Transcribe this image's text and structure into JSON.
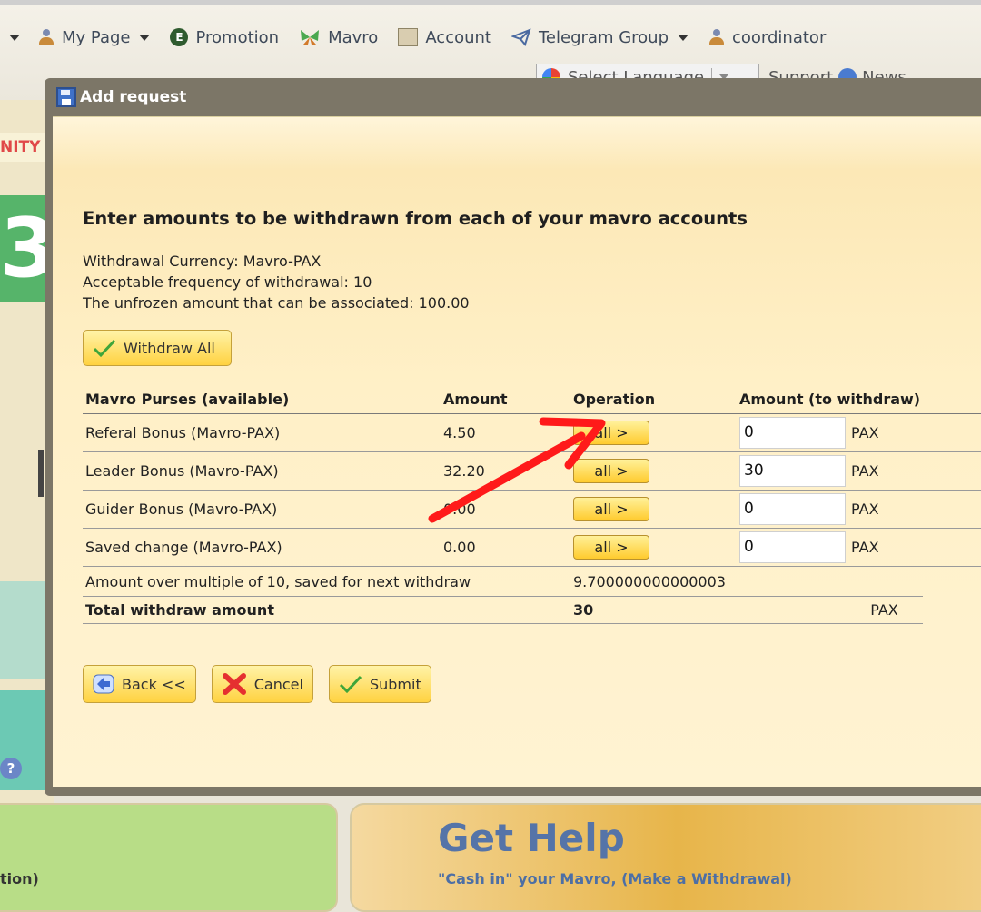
{
  "nav": {
    "items": [
      {
        "label": "My Page",
        "icon": "person-icon"
      },
      {
        "label": "Promotion",
        "icon": "e-badge-icon"
      },
      {
        "label": "Mavro",
        "icon": "butterfly-icon"
      },
      {
        "label": "Account",
        "icon": "ledger-icon"
      },
      {
        "label": "Telegram Group",
        "icon": "telegram-icon"
      },
      {
        "label": "coordinator",
        "icon": "person-icon"
      }
    ],
    "language_label": "Select Language",
    "support": "Support",
    "news": "News"
  },
  "left_panel": {
    "nity": "NITY",
    "big_digit": "3",
    "help_icon": "?"
  },
  "dialog": {
    "title": "Add request",
    "heading": "Enter amounts to be withdrawn from each of your mavro accounts",
    "info": [
      "Withdrawal Currency: Mavro-PAX",
      "Acceptable frequency of withdrawal: 10",
      "The unfrozen amount that can be associated: 100.00"
    ],
    "withdraw_all": "Withdraw All",
    "table": {
      "headers": [
        "Mavro Purses (available)",
        "Amount",
        "Operation",
        "Amount (to withdraw)"
      ],
      "rows": [
        {
          "purse": "Referal Bonus (Mavro-PAX)",
          "amount": "4.50",
          "op": "all >",
          "value": "0",
          "unit": "PAX"
        },
        {
          "purse": "Leader Bonus (Mavro-PAX)",
          "amount": "32.20",
          "op": "all >",
          "value": "30",
          "unit": "PAX"
        },
        {
          "purse": "Guider Bonus (Mavro-PAX)",
          "amount": "0.00",
          "op": "all >",
          "value": "0",
          "unit": "PAX"
        },
        {
          "purse": "Saved change (Mavro-PAX)",
          "amount": "0.00",
          "op": "all >",
          "value": "0",
          "unit": "PAX"
        }
      ]
    },
    "saved_label": "Amount over multiple of 10, saved for next withdraw",
    "saved_value": "9.700000000000003",
    "total_label": "Total withdraw amount",
    "total_value": "30",
    "total_unit": "PAX",
    "buttons": {
      "back": "Back <<",
      "cancel": "Cancel",
      "submit": "Submit"
    }
  },
  "bottom": {
    "left_text": "tion)",
    "get_help_title": "Get Help",
    "get_help_sub": "\"Cash in\" your Mavro, (Make a Withdrawal)"
  },
  "colors": {
    "annotation_arrow": "#ff1a1a",
    "button_yellow": "#ffd240",
    "dialog_frame": "#7c7667"
  }
}
